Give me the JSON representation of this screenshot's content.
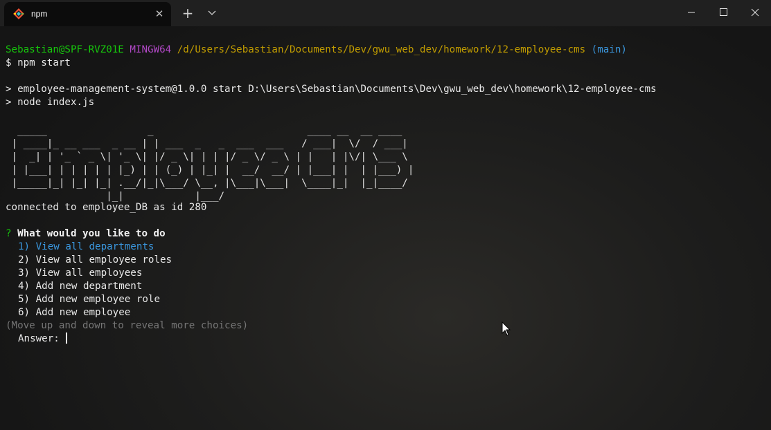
{
  "titlebar": {
    "tab_title": "npm",
    "tab_icon": "git-bash-icon",
    "close_glyph": "✕",
    "new_tab_glyph": "+"
  },
  "terminal": {
    "prompt": {
      "user_host": "Sebastian@SPF-RVZ01E",
      "env": "MINGW64",
      "path": "/d/Users/Sebastian/Documents/Dev/gwu_web_dev/homework/12-employee-cms",
      "branch": "(main)",
      "command": "$ npm start"
    },
    "script_line1": "> employee-management-system@1.0.0 start D:\\Users\\Sebastian\\Documents\\Dev\\gwu_web_dev\\homework\\12-employee-cms",
    "script_line2": "> node index.js",
    "ascii_banner": "  _____                 _                          ____ __  __ ____\n | ____|_ __ ___  _ __ | | ___  _   _  ___  ___   / ___|  \\/  / ___|\n |  _| | '_ ` _ \\| '_ \\| |/ _ \\| | | |/ _ \\/ _ \\ | |   | |\\/| \\___ \\\n | |___| | | | | | |_) | | (_) | |_| |  __/  __/ | |___| |  | |___) |\n |_____|_| |_| |_| .__/|_|\\___/ \\__, |\\___|\\___|  \\____|_|  |_|____/\n                 |_|            |___/",
    "connected": "connected to employee_DB as id 280",
    "question_mark": "?",
    "question": "What would you like to do",
    "choices": [
      "1) View all departments",
      "2) View all employee roles",
      "3) View all employees",
      "4) Add new department",
      "5) Add new employee role",
      "6) Add new employee"
    ],
    "hint": "(Move up and down to reveal more choices)",
    "answer_label": "Answer:"
  },
  "colors": {
    "prompt_user": "#16c60c",
    "prompt_env": "#b148c6",
    "prompt_path": "#c19c00",
    "prompt_branch": "#3a96dd",
    "highlight_choice": "#3a96dd"
  }
}
